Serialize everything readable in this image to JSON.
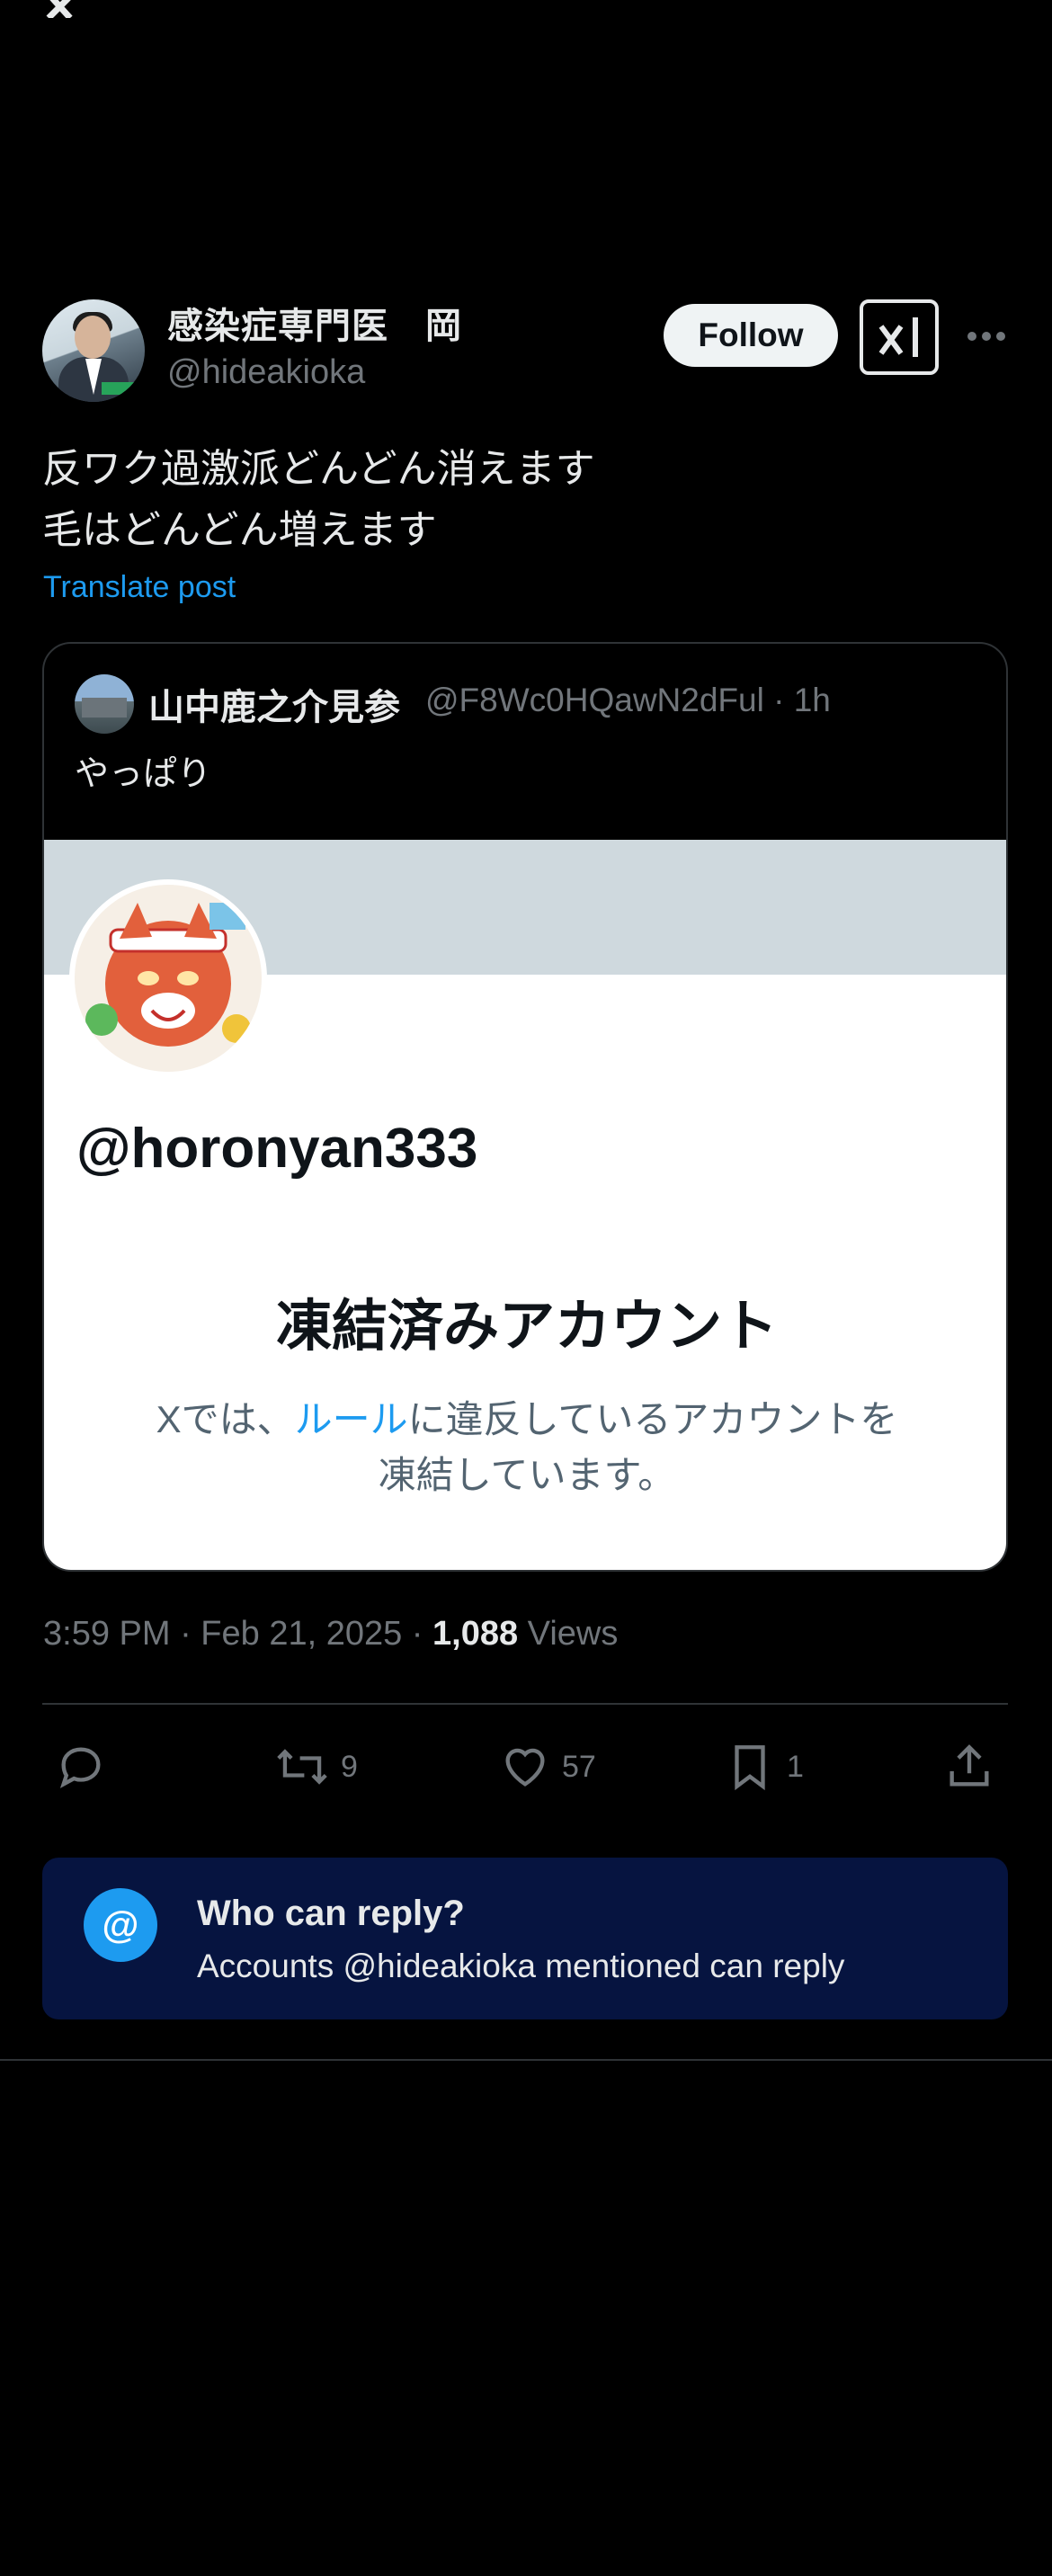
{
  "author": {
    "name": "感染症専門医　岡",
    "handle": "@hideakioka",
    "follow_label": "Follow"
  },
  "post": {
    "text": "反ワク過激派どんどん消えます\n毛はどんどん増えます",
    "translate_label": "Translate post",
    "time": "3:59 PM · Feb 21, 2025 · ",
    "views_count": "1,088",
    "views_label": " Views"
  },
  "quote": {
    "name": "山中鹿之介見参",
    "handle_time": "@F8Wc0HQawN2dFul · 1h",
    "text": "やっぱり",
    "suspended_handle": "@horonyan333",
    "suspended_title": "凍結済みアカウント",
    "suspended_desc_pre": "Xでは、",
    "suspended_desc_link": "ルール",
    "suspended_desc_post": "に違反しているアカウントを",
    "suspended_desc_line2": "凍結しています。"
  },
  "actions": {
    "reply_icon": "reply-icon",
    "repost_count": "9",
    "like_count": "57",
    "bookmark_count": "1",
    "share_icon": "share-icon"
  },
  "who_can_reply": {
    "icon": "@",
    "title": "Who can reply?",
    "subtitle": "Accounts @hideakioka mentioned can reply"
  },
  "colors": {
    "accent": "#1d9bf0",
    "background": "#000000",
    "muted": "#71767b",
    "reply_box": "#061440"
  }
}
